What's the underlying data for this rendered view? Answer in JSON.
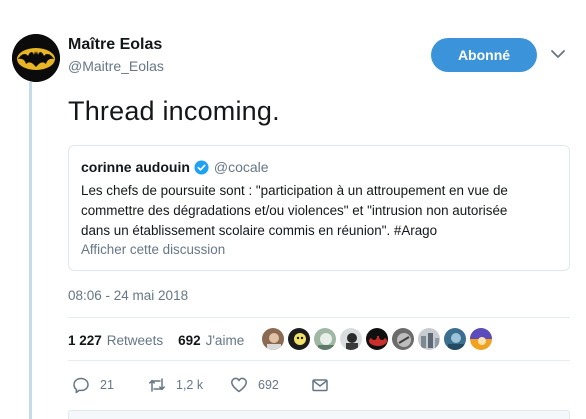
{
  "author": {
    "display_name": "Maître Eolas",
    "handle": "@Maitre_Eolas",
    "avatar_icon": "bat-logo-icon"
  },
  "follow_button": {
    "label": "Abonné",
    "color": "#3b94d9"
  },
  "tweet": {
    "text": "Thread incoming."
  },
  "quoted_tweet": {
    "name": "corinne audouin",
    "handle": "@cocale",
    "verified": true,
    "lines": [
      "Les chefs de poursuite sont : \"participation à un attroupement en vue de",
      "commettre des dégradations et/ou violences\" et \"intrusion non autorisée",
      "dans un établissement scolaire commis en réunion\". #Arago"
    ],
    "show_thread": "Afficher cette discussion"
  },
  "timestamp": "08:06 - 24 mai 2018",
  "stats": {
    "retweets_count": "1 227",
    "retweets_label": "Retweets",
    "likes_count": "692",
    "likes_label": "J'aime"
  },
  "likers_count_shown": 9,
  "actions": {
    "reply_count": "21",
    "retweet_count": "1,2 k",
    "like_count": "692"
  },
  "colors": {
    "accent": "#3b94d9",
    "thread_line": "#c4dbe8",
    "secondary_text": "#657786"
  }
}
